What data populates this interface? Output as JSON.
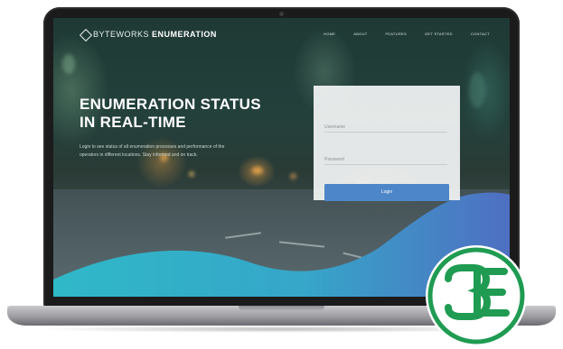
{
  "brand": {
    "name_light": "BYTEWORKS",
    "name_bold": "ENUMERATION"
  },
  "nav": {
    "items": [
      "Home",
      "About",
      "Features",
      "Get Started",
      "Contact"
    ]
  },
  "hero": {
    "title_line1": "ENUMERATION STATUS",
    "title_line2": "IN REAL-TIME",
    "description": "Login to see status of all enumeration processes and performance of the operators in different locations. Stay informed and on track."
  },
  "login": {
    "username_placeholder": "Username",
    "password_placeholder": "Password",
    "button_label": "Login"
  },
  "badge": {
    "text": "3E",
    "ring_color": "#1f9b52"
  },
  "colors": {
    "wave_start": "#2fb8c8",
    "wave_end": "#4f6fc2",
    "button": "#4d86c9"
  }
}
